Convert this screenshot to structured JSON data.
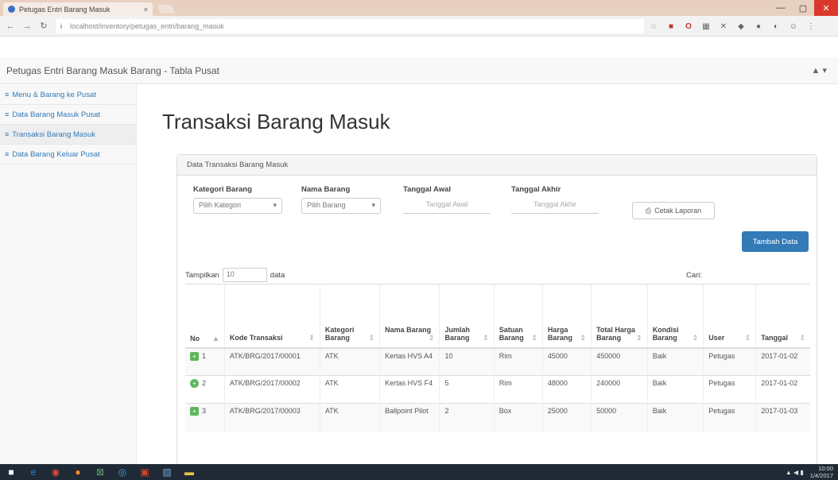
{
  "browser": {
    "tab_title": "Petugas Entri Barang Masuk",
    "tab_close": "×",
    "url_secure": "i",
    "url": "localhost/inventory/petugas_entri/barang_masuk",
    "win_min": "—",
    "win_max": "▢",
    "win_close": "✕"
  },
  "app": {
    "brand": "Petugas Entri Barang Masuk Barang - Tabla Pusat",
    "user": "▲ ▾"
  },
  "sidebar": {
    "items": [
      {
        "icon": "≡",
        "label": "Menu & Barang ke Pusat"
      },
      {
        "icon": "≡",
        "label": "Data Barang Masuk Pusat"
      },
      {
        "icon": "≡",
        "label": "Transaksi Barang Masuk"
      },
      {
        "icon": "≡",
        "label": "Data Barang Keluar Pusat"
      }
    ]
  },
  "main": {
    "title": "Transaksi Barang Masuk",
    "panel_heading": "Data Transaksi Barang Masuk",
    "filters": {
      "kategori_label": "Kategori Barang",
      "kategori_value": "Pilih Kategori",
      "nama_label": "Nama Barang",
      "nama_value": "Pilih Barang",
      "awal_label": "Tanggal Awal",
      "awal_placeholder": "Tanggal Awal",
      "akhir_label": "Tanggal Akhir",
      "akhir_placeholder": "Tanggal Akhir",
      "print_label": "Cetak Laporan"
    },
    "add_button": "Tambah Data",
    "length_label_pre": "Tampilkan",
    "length_value": "10",
    "length_label_post": "data",
    "search_label": "Cari:"
  },
  "table": {
    "headers": [
      "No",
      "Kode Transaksi",
      "Kategori Barang",
      "Nama Barang",
      "Jumlah Barang",
      "Satuan Barang",
      "Harga Barang",
      "Total Harga Barang",
      "Kondisi Barang",
      "User",
      "Tanggal"
    ],
    "rows": [
      {
        "no": "1",
        "kode": "ATK/BRG/2017/00001",
        "kategori": "ATK",
        "nama": "Kertas HVS A4",
        "jumlah": "10",
        "satuan": "Rim",
        "harga": "45000",
        "total": "450000",
        "kondisi": "Baik",
        "user": "Petugas",
        "tanggal": "2017-01-02"
      },
      {
        "no": "2",
        "kode": "ATK/BRG/2017/00002",
        "kategori": "ATK",
        "nama": "Kertas HVS F4",
        "jumlah": "5",
        "satuan": "Rim",
        "harga": "48000",
        "total": "240000",
        "kondisi": "Baik",
        "user": "Petugas",
        "tanggal": "2017-01-02"
      },
      {
        "no": "3",
        "kode": "ATK/BRG/2017/00003",
        "kategori": "ATK",
        "nama": "Ballpoint Pilot",
        "jumlah": "2",
        "satuan": "Box",
        "harga": "25000",
        "total": "50000",
        "kondisi": "Baik",
        "user": "Petugas",
        "tanggal": "2017-01-03"
      }
    ]
  },
  "taskbar": {
    "clock_time": "10:00",
    "clock_date": "1/4/2017",
    "tray": "▲ ◀ ▮"
  }
}
